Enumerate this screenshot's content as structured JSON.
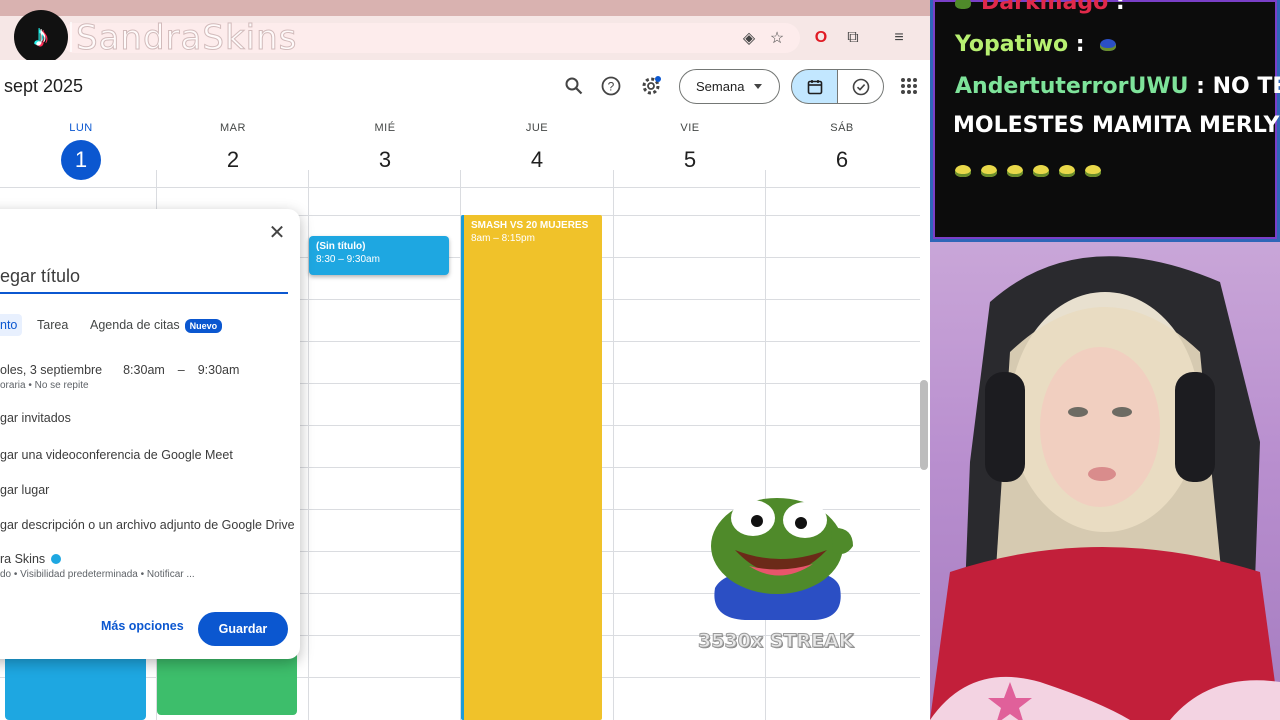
{
  "stream_overlay": {
    "handle": "SandraSkins",
    "streak_text": "3530x STREAK"
  },
  "calendar": {
    "current_period": "sept 2025",
    "view_label": "Semana",
    "days": [
      {
        "name": "LUN",
        "num": "1"
      },
      {
        "name": "MAR",
        "num": "2"
      },
      {
        "name": "MIÉ",
        "num": "3"
      },
      {
        "name": "JUE",
        "num": "4"
      },
      {
        "name": "VIE",
        "num": "5"
      },
      {
        "name": "SÁB",
        "num": "6"
      }
    ],
    "events": {
      "sin_titulo": {
        "title": "(Sin título)",
        "time": "8:30 – 9:30am"
      },
      "smash": {
        "title": "SMASH VS 20 MUJERES",
        "time": "8am – 8:15pm"
      }
    }
  },
  "dialog": {
    "title_placeholder": "egar título",
    "tabs": {
      "event": "nto",
      "task": "Tarea",
      "appointments": "Agenda de citas",
      "badge": "Nuevo"
    },
    "date": "oles, 3 septiembre",
    "start": "8:30am",
    "dash": "–",
    "end": "9:30am",
    "repeat": "oraria • No se repite",
    "guests": "gar invitados",
    "meet": "gar una videoconferencia de Google Meet",
    "location": "gar lugar",
    "description": "gar descripción o un archivo adjunto de Google Drive",
    "calendar_owner": "ra Skins",
    "visibility": "do • Visibilidad predeterminada • Notificar ...",
    "more_options": "Más opciones",
    "save": "Guardar"
  },
  "chat": {
    "lines": [
      {
        "user": "Darkmago",
        "sep": " :"
      },
      {
        "user": "Yopatiwo",
        "sep": " :"
      },
      {
        "user": "AndertuterrorUWU",
        "sep": " : ",
        "msg": "NO TE",
        "msg2": "MOLESTES MAMITA MERLY"
      }
    ]
  },
  "colors": {
    "accent": "#0b57d0",
    "event_blue": "#1ea7e1",
    "event_yellow": "#f0c22a",
    "event_green": "#3dbe6b"
  }
}
